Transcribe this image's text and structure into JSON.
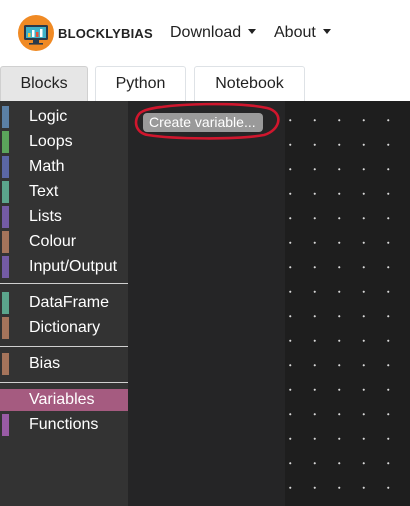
{
  "navbar": {
    "brand": "BLOCKLYBIAS",
    "download_label": "Download",
    "about_label": "About"
  },
  "tabs": [
    {
      "label": "Blocks",
      "active": true
    },
    {
      "label": "Python",
      "active": false
    },
    {
      "label": "Notebook",
      "active": false
    }
  ],
  "toolbox": {
    "categories": [
      {
        "label": "Logic",
        "color": "#5b80a5"
      },
      {
        "label": "Loops",
        "color": "#5ba55b"
      },
      {
        "label": "Math",
        "color": "#5b67a5"
      },
      {
        "label": "Text",
        "color": "#5ba58c"
      },
      {
        "label": "Lists",
        "color": "#745ba5"
      },
      {
        "label": "Colour",
        "color": "#a5745b"
      },
      {
        "label": "Input/Output",
        "color": "#745ba5"
      },
      {
        "label": "DataFrame",
        "color": "#5ba58c"
      },
      {
        "label": "Dictionary",
        "color": "#a5745b"
      },
      {
        "label": "Bias",
        "color": "#a5745b"
      },
      {
        "label": "Variables",
        "color": "#a55b80",
        "selected": true
      },
      {
        "label": "Functions",
        "color": "#995ba5"
      }
    ]
  },
  "flyout": {
    "create_variable_label": "Create variable..."
  },
  "colors": {
    "highlight_circle": "#d0162d",
    "toolbox_bg": "#333333",
    "workspace_bg": "#1e1e1e"
  }
}
